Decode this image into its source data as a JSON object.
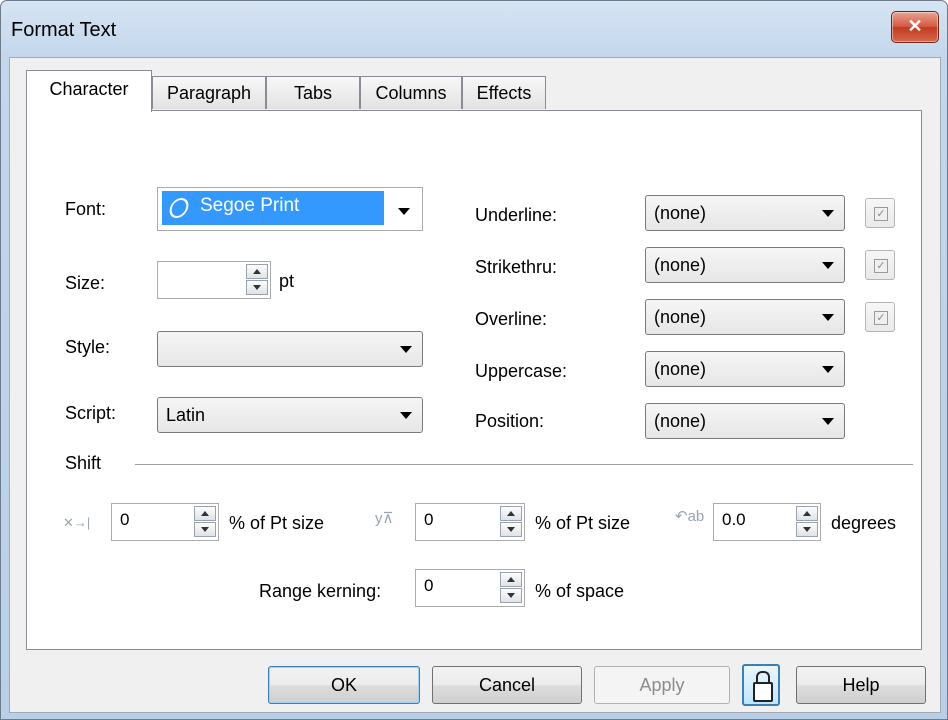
{
  "window": {
    "title": "Format Text",
    "close_label": "✕"
  },
  "tabs": [
    {
      "label": "Character"
    },
    {
      "label": "Paragraph"
    },
    {
      "label": "Tabs"
    },
    {
      "label": "Columns"
    },
    {
      "label": "Effects"
    }
  ],
  "character": {
    "font_label": "Font:",
    "font_value": "Segoe Print",
    "size_label": "Size:",
    "size_value": "",
    "size_unit": "pt",
    "style_label": "Style:",
    "style_value": "",
    "script_label": "Script:",
    "script_value": "Latin",
    "underline_label": "Underline:",
    "underline_value": "(none)",
    "strikethru_label": "Strikethru:",
    "strikethru_value": "(none)",
    "overline_label": "Overline:",
    "overline_value": "(none)",
    "uppercase_label": "Uppercase:",
    "uppercase_value": "(none)",
    "position_label": "Position:",
    "position_value": "(none)"
  },
  "shift": {
    "title": "Shift",
    "horizontal_value": "0",
    "horizontal_unit": "% of Pt size",
    "vertical_value": "0",
    "vertical_unit": "% of Pt size",
    "rotation_value": "0.0",
    "rotation_unit": "degrees",
    "range_kerning_label": "Range kerning:",
    "range_kerning_value": "0",
    "range_kerning_unit": "% of space"
  },
  "buttons": {
    "ok": "OK",
    "cancel": "Cancel",
    "apply": "Apply",
    "help": "Help"
  },
  "icons": {
    "horizontal_shift": "horizontal-shift-icon",
    "vertical_shift": "vertical-shift-icon",
    "rotation": "rotation-icon",
    "lock": "lock-icon",
    "font_type": "opentype-font-icon"
  }
}
